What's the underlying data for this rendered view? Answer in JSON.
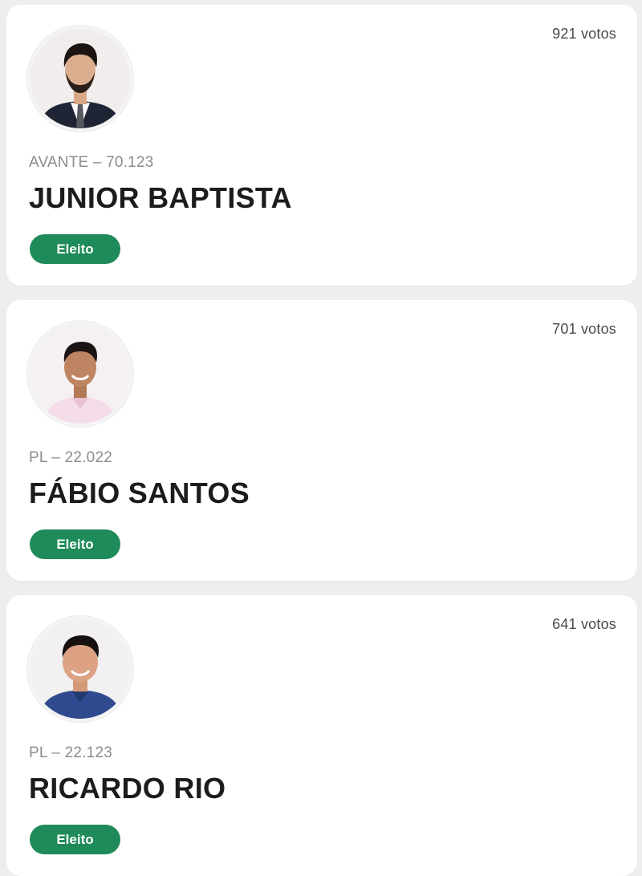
{
  "candidates": [
    {
      "votes": "921 votos",
      "party_number": "AVANTE – 70.123",
      "name": "JUNIOR BAPTISTA",
      "status": "Eleito",
      "photo": "candidate-photo-man-dark-suit-tie"
    },
    {
      "votes": "701 votos",
      "party_number": "PL – 22.022",
      "name": "FÁBIO SANTOS",
      "status": "Eleito",
      "photo": "candidate-photo-man-pink-shirt"
    },
    {
      "votes": "641 votos",
      "party_number": "PL – 22.123",
      "name": "RICARDO RIO",
      "status": "Eleito",
      "photo": "candidate-photo-man-blue-shirt"
    }
  ],
  "colors": {
    "badge": "#1f8a5a",
    "card": "#ffffff",
    "background": "#eeeeee"
  }
}
